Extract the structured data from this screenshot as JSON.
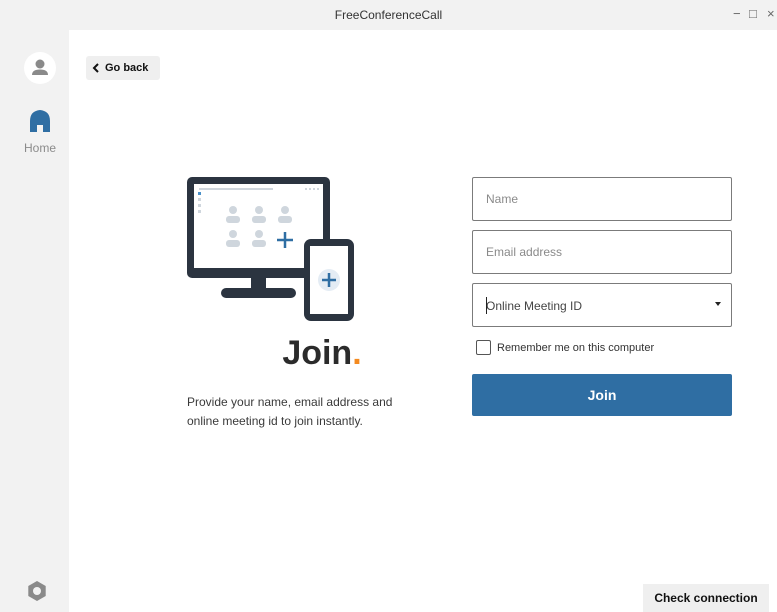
{
  "window": {
    "title": "FreeConferenceCall",
    "minimize": "−",
    "maximize": "□",
    "close": "×"
  },
  "sidebar": {
    "home_label": "Home"
  },
  "nav": {
    "go_back_label": "Go back"
  },
  "hero": {
    "title": "Join",
    "title_dot": ".",
    "description": "Provide your name, email address and online meeting id to join instantly."
  },
  "form": {
    "name_placeholder": "Name",
    "email_placeholder": "Email address",
    "meeting_id_value": "Online Meeting ID",
    "remember_label": "Remember me on this computer",
    "join_label": "Join"
  },
  "footer": {
    "check_connection_label": "Check connection"
  },
  "colors": {
    "accent_blue": "#2f6ea3",
    "accent_orange": "#f48a1f",
    "illustration_dark": "#2b3440",
    "illustration_light": "#cfd6dd",
    "home_icon": "#2f6ea3",
    "sidebar_bg": "#f2f2f2"
  }
}
